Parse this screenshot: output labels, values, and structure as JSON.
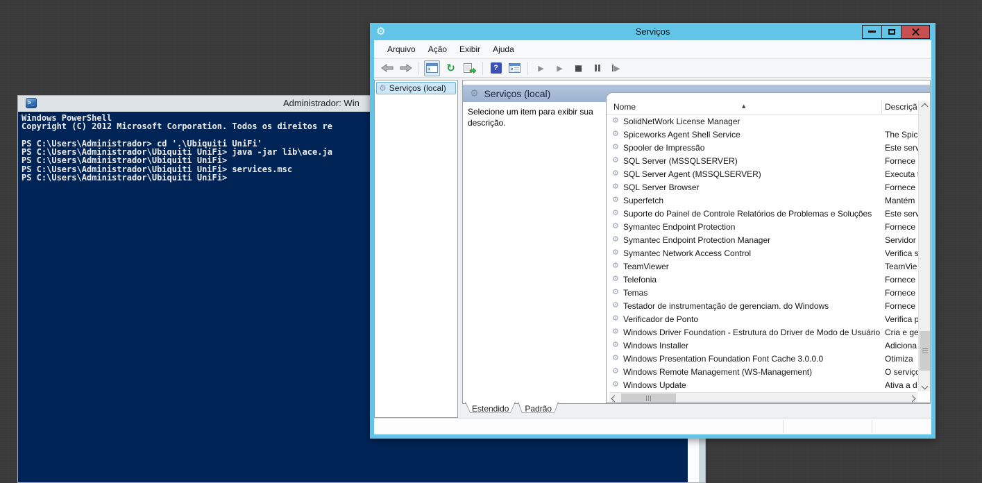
{
  "colors": {
    "desktop": "#3a3a3a",
    "services_accent": "#62c5e7",
    "close_button": "#c75050",
    "console_background": "#012456",
    "console_text": "#efefef",
    "band_gradient": [
      "#b4c4dc",
      "#9db3d0"
    ]
  },
  "powershell": {
    "title": "Administrador: Win",
    "icon": "powershell-icon",
    "icon_glyph": ">_",
    "lines": [
      "Windows PowerShell",
      "Copyright (C) 2012 Microsoft Corporation. Todos os direitos re",
      "",
      "PS C:\\Users\\Administrador> cd '.\\Ubiquiti UniFi'",
      "PS C:\\Users\\Administrador\\Ubiquiti UniFi> java -jar lib\\ace.ja",
      "PS C:\\Users\\Administrador\\Ubiquiti UniFi>",
      "PS C:\\Users\\Administrador\\Ubiquiti UniFi> services.msc",
      "PS C:\\Users\\Administrador\\Ubiquiti UniFi>"
    ]
  },
  "services": {
    "title": "Serviços",
    "window_icon": "services-gear-icon",
    "window_controls": [
      "minimize",
      "maximize",
      "close"
    ],
    "menu": [
      {
        "label": "Arquivo"
      },
      {
        "label": "Ação"
      },
      {
        "label": "Exibir"
      },
      {
        "label": "Ajuda"
      }
    ],
    "toolbar_icons": [
      "back-icon",
      "forward-icon",
      "show-console-tree-icon",
      "refresh-icon",
      "export-list-icon",
      "help-icon",
      "extended-view-icon",
      "start-service-icon",
      "start-service-icon",
      "stop-service-icon",
      "pause-service-icon",
      "restart-service-icon"
    ],
    "help_glyph": "?",
    "refresh_glyph": "↻",
    "play_glyph": "▶",
    "stop_glyph": "■",
    "sort_glyph": "▲",
    "tree_root": "Serviços (local)",
    "panel_title": "Serviços (local)",
    "hint": "Selecione um item para exibir sua descrição.",
    "columns": {
      "name": "Nome",
      "description": "Descrição"
    },
    "tabs": [
      {
        "label": "Estendido"
      },
      {
        "label": "Padrão"
      }
    ],
    "rows": [
      {
        "name": "SolidNetWork License Manager",
        "desc": ""
      },
      {
        "name": "Spiceworks Agent Shell Service",
        "desc": "The Spic"
      },
      {
        "name": "Spooler de Impressão",
        "desc": "Este serv"
      },
      {
        "name": "SQL Server (MSSQLSERVER)",
        "desc": "Fornece"
      },
      {
        "name": "SQL Server Agent (MSSQLSERVER)",
        "desc": "Executa t"
      },
      {
        "name": "SQL Server Browser",
        "desc": "Fornece"
      },
      {
        "name": "Superfetch",
        "desc": "Mantém"
      },
      {
        "name": "Suporte do Painel de Controle Relatórios de Problemas e Soluções",
        "desc": "Este serv"
      },
      {
        "name": "Symantec Endpoint Protection",
        "desc": "Fornece"
      },
      {
        "name": "Symantec Endpoint Protection Manager",
        "desc": "Servidor"
      },
      {
        "name": "Symantec Network Access Control",
        "desc": "Verifica s"
      },
      {
        "name": "TeamViewer",
        "desc": "TeamVie"
      },
      {
        "name": "Telefonia",
        "desc": "Fornece"
      },
      {
        "name": "Temas",
        "desc": "Fornece"
      },
      {
        "name": "Testador de instrumentação de gerenciam. do Windows",
        "desc": "Fornece"
      },
      {
        "name": "Verificador de Ponto",
        "desc": "Verifica p"
      },
      {
        "name": "Windows Driver Foundation - Estrutura do Driver de Modo de Usuário",
        "desc": "Cria e ge"
      },
      {
        "name": "Windows Installer",
        "desc": "Adiciona"
      },
      {
        "name": "Windows Presentation Foundation Font Cache 3.0.0.0",
        "desc": "Otimiza"
      },
      {
        "name": "Windows Remote Management (WS-Management)",
        "desc": "O serviço"
      },
      {
        "name": "Windows Update",
        "desc": "Ativa a d"
      }
    ]
  }
}
